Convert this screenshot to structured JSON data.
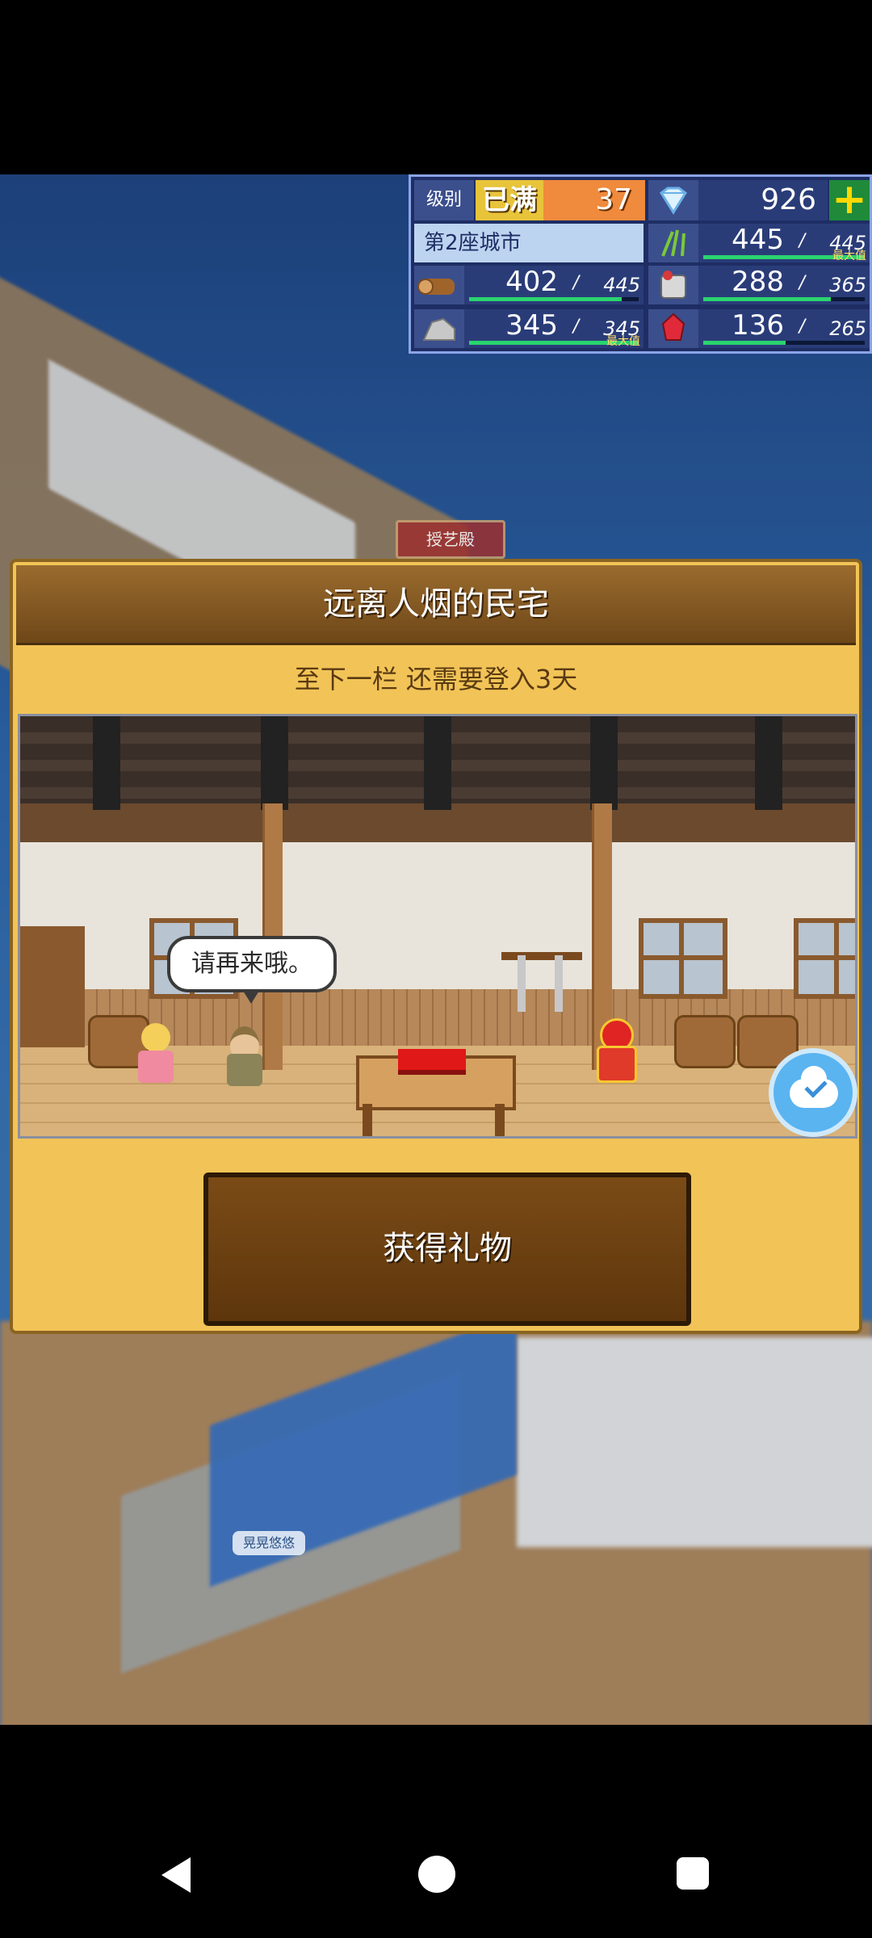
{
  "stats": {
    "level_label": "级别",
    "level_full": "已满",
    "level_value": "37",
    "gems": "926",
    "city": "第2座城市",
    "resources": [
      {
        "name": "food",
        "icon": "wheat-icon",
        "current": "445",
        "max": "445",
        "fill": 1.0,
        "tag": "最大值"
      },
      {
        "name": "wood",
        "icon": "log-icon",
        "current": "402",
        "max": "445",
        "fill": 0.9,
        "tag": ""
      },
      {
        "name": "material",
        "icon": "bag-icon",
        "current": "288",
        "max": "365",
        "fill": 0.79,
        "tag": ""
      },
      {
        "name": "stone",
        "icon": "ore-icon",
        "current": "345",
        "max": "345",
        "fill": 1.0,
        "tag": "最大值"
      },
      {
        "name": "ruby",
        "icon": "ruby-icon",
        "current": "136",
        "max": "265",
        "fill": 0.51,
        "tag": ""
      }
    ]
  },
  "map": {
    "building_label": "授艺殿",
    "nameplate": "晃晃悠悠"
  },
  "dialog": {
    "title": "远离人烟的民宅",
    "subtitle": "至下一栏 还需要登入3天",
    "speech": "请再来哦。",
    "claim_button": "获得礼物"
  },
  "buttons": {
    "back": "返回"
  }
}
